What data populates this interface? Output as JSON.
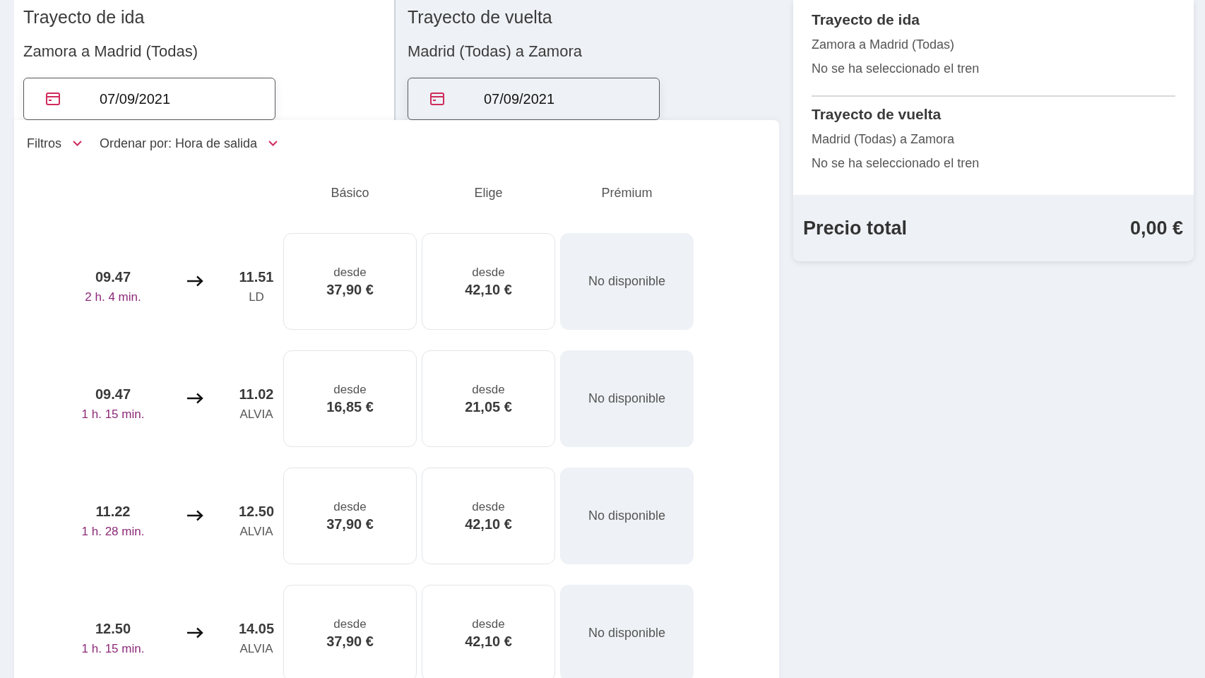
{
  "legs": [
    {
      "title": "Trayecto de ida",
      "route": "Zamora a Madrid (Todas)",
      "date": "07/09/2021",
      "selected": true
    },
    {
      "title": "Trayecto de vuelta",
      "route": "Madrid (Todas) a Zamora",
      "date": "07/09/2021",
      "selected": false
    }
  ],
  "toolbar": [
    {
      "label": "Filtros"
    },
    {
      "label": "Ordenar por: Hora de salida"
    }
  ],
  "fare_columns": [
    "Básico",
    "Elige",
    "Prémium"
  ],
  "trains": [
    {
      "departure": "09.47",
      "duration": "2 h. 4 min.",
      "arrival": "11.51",
      "service": "LD",
      "fares": [
        {
          "kind": "price",
          "label": "desde",
          "price": "37,90 €"
        },
        {
          "kind": "price",
          "label": "desde",
          "price": "42,10 €"
        },
        {
          "kind": "unavailable",
          "label": "No disponible"
        }
      ]
    },
    {
      "departure": "09.47",
      "duration": "1 h. 15 min.",
      "arrival": "11.02",
      "service": "ALVIA",
      "fares": [
        {
          "kind": "price",
          "label": "desde",
          "price": "16,85 €"
        },
        {
          "kind": "price",
          "label": "desde",
          "price": "21,05 €"
        },
        {
          "kind": "unavailable",
          "label": "No disponible"
        }
      ]
    },
    {
      "departure": "11.22",
      "duration": "1 h. 28 min.",
      "arrival": "12.50",
      "service": "ALVIA",
      "fares": [
        {
          "kind": "price",
          "label": "desde",
          "price": "37,90 €"
        },
        {
          "kind": "price",
          "label": "desde",
          "price": "42,10 €"
        },
        {
          "kind": "unavailable",
          "label": "No disponible"
        }
      ]
    },
    {
      "departure": "12.50",
      "duration": "1 h. 15 min.",
      "arrival": "14.05",
      "service": "ALVIA",
      "fares": [
        {
          "kind": "price",
          "label": "desde",
          "price": "37,90 €"
        },
        {
          "kind": "price",
          "label": "desde",
          "price": "42,10 €"
        },
        {
          "kind": "unavailable",
          "label": "No disponible"
        }
      ]
    }
  ],
  "summary": {
    "legs": [
      {
        "title": "Trayecto de ida",
        "route": "Zamora a Madrid (Todas)",
        "status": "No se ha seleccionado el tren"
      },
      {
        "title": "Trayecto de vuelta",
        "route": "Madrid (Todas) a Zamora",
        "status": "No se ha seleccionado el tren"
      }
    ],
    "total_label": "Precio total",
    "total": "0,00 €"
  }
}
